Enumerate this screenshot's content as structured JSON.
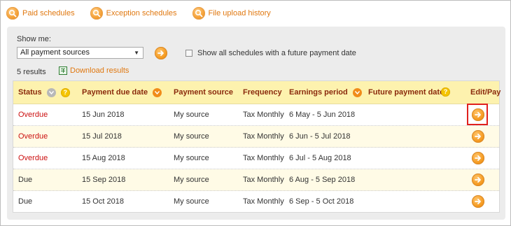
{
  "tabs": [
    {
      "label": "Paid schedules",
      "icon": "search-icon"
    },
    {
      "label": "Exception schedules",
      "icon": "search-icon"
    },
    {
      "label": "File upload history",
      "icon": "search-icon"
    }
  ],
  "filter": {
    "show_me_label": "Show me:",
    "source_select_value": "All payment sources",
    "future_checkbox_label": "Show all schedules with a future payment date",
    "future_checkbox_checked": false
  },
  "results": {
    "count_label": "5 results",
    "download_label": "Download results"
  },
  "table": {
    "headers": {
      "status": "Status",
      "payment_due_date": "Payment due date",
      "payment_source": "Payment source",
      "frequency": "Frequency",
      "earnings_period": "Earnings period",
      "future_payment_date": "Future payment date",
      "edit_pay": "Edit/Pay"
    },
    "rows": [
      {
        "status": "Overdue",
        "due_date": "15 Jun 2018",
        "source": "My source",
        "frequency": "Tax Monthly",
        "period": "6 May - 5 Jun 2018",
        "future_date": ""
      },
      {
        "status": "Overdue",
        "due_date": "15 Jul 2018",
        "source": "My source",
        "frequency": "Tax Monthly",
        "period": "6 Jun - 5 Jul 2018",
        "future_date": ""
      },
      {
        "status": "Overdue",
        "due_date": "15 Aug 2018",
        "source": "My source",
        "frequency": "Tax Monthly",
        "period": "6 Jul - 5 Aug 2018",
        "future_date": ""
      },
      {
        "status": "Due",
        "due_date": "15 Sep 2018",
        "source": "My source",
        "frequency": "Tax Monthly",
        "period": "6 Aug - 5 Sep 2018",
        "future_date": ""
      },
      {
        "status": "Due",
        "due_date": "15 Oct 2018",
        "source": "My source",
        "frequency": "Tax Monthly",
        "period": "6 Sep - 5 Oct 2018",
        "future_date": ""
      }
    ]
  },
  "colors": {
    "accent_orange": "#f59a20",
    "link_orange": "#e07810",
    "overdue_red": "#cc1111",
    "header_bg": "#fdf2ae",
    "header_text": "#8a2a0c",
    "highlight_red": "#e0211d"
  }
}
